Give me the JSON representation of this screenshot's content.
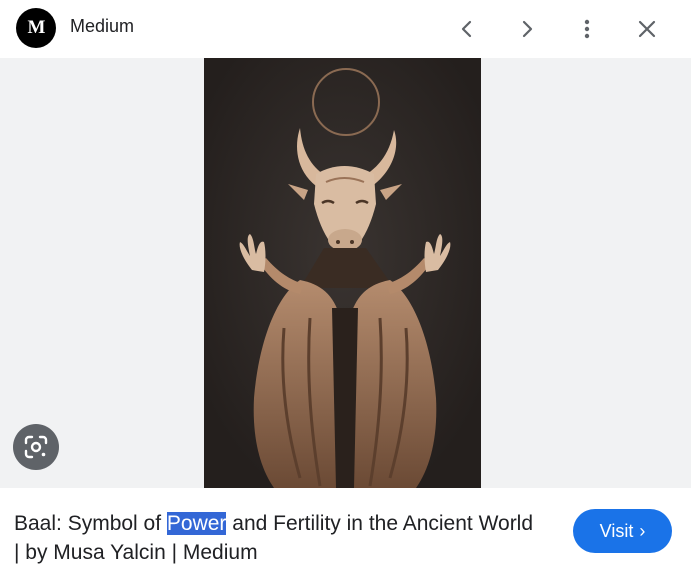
{
  "header": {
    "source_logo_text": "M",
    "source_name": "Medium",
    "icons": [
      "chevron-left-icon",
      "chevron-right-icon",
      "more-vert-icon",
      "close-icon"
    ]
  },
  "image": {
    "subject": "Baal bull-headed figure with raised hands under a halo",
    "lens_icon": "google-lens-icon"
  },
  "caption": {
    "before": "Baal: Symbol of ",
    "highlight": "Power",
    "after": " and Fertility in the Ancient World | by Musa Yalcin | Medium"
  },
  "visit": {
    "label": "Visit",
    "chevron": "›"
  },
  "colors": {
    "accent": "#1a73e8",
    "highlight": "#3367d6",
    "panel_bg": "#f1f2f3"
  }
}
